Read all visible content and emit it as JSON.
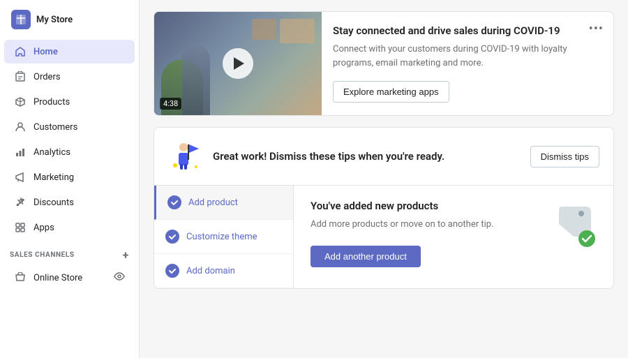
{
  "sidebar": {
    "logo": {
      "icon": "S",
      "store_name": "My Store"
    },
    "nav_items": [
      {
        "id": "home",
        "label": "Home",
        "icon": "home",
        "active": true
      },
      {
        "id": "orders",
        "label": "Orders",
        "icon": "orders",
        "active": false
      },
      {
        "id": "products",
        "label": "Products",
        "icon": "products",
        "active": false
      },
      {
        "id": "customers",
        "label": "Customers",
        "icon": "customers",
        "active": false
      },
      {
        "id": "analytics",
        "label": "Analytics",
        "icon": "analytics",
        "active": false
      },
      {
        "id": "marketing",
        "label": "Marketing",
        "icon": "marketing",
        "active": false
      },
      {
        "id": "discounts",
        "label": "Discounts",
        "icon": "discounts",
        "active": false
      },
      {
        "id": "apps",
        "label": "Apps",
        "icon": "apps",
        "active": false
      }
    ],
    "sales_channels_label": "SALES CHANNELS",
    "online_store_label": "Online Store"
  },
  "video_card": {
    "title": "Stay connected and drive sales during COVID-19",
    "description": "Connect with your customers during COVID-19 with loyalty programs, email marketing and more.",
    "explore_btn": "Explore marketing apps",
    "duration": "4:38",
    "more_icon": "•••"
  },
  "tips_card": {
    "header_title": "Great work! Dismiss these tips when you're ready.",
    "dismiss_btn": "Dismiss tips",
    "list_items": [
      {
        "id": "add-product",
        "label": "Add product",
        "completed": true,
        "active": true
      },
      {
        "id": "customize-theme",
        "label": "Customize theme",
        "completed": true,
        "active": false
      },
      {
        "id": "add-domain",
        "label": "Add domain",
        "completed": true,
        "active": false
      }
    ],
    "detail": {
      "title": "You've added new products",
      "description": "Add more products or move on to another tip.",
      "action_btn": "Add another product"
    }
  }
}
